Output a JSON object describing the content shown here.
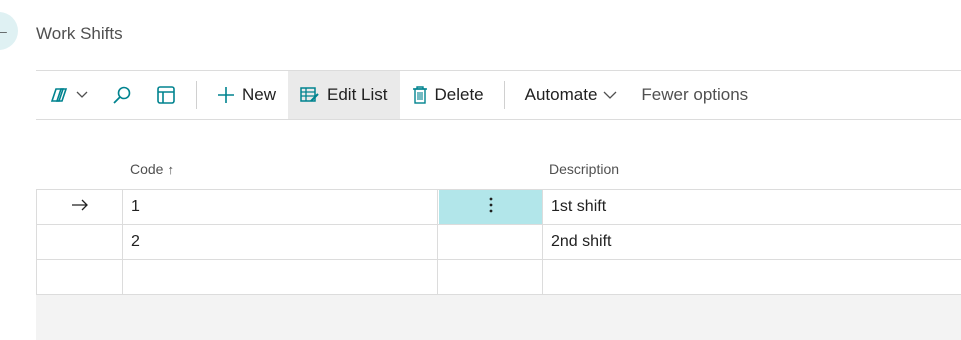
{
  "page": {
    "title": "Work Shifts"
  },
  "toolbar": {
    "new_label": "New",
    "edit_list_label": "Edit List",
    "delete_label": "Delete",
    "automate_label": "Automate",
    "fewer_options_label": "Fewer options"
  },
  "grid": {
    "columns": {
      "code": "Code",
      "description": "Description"
    },
    "sort_indicator": "↑",
    "rows": [
      {
        "code": "1",
        "description": "1st shift",
        "selected": true
      },
      {
        "code": "2",
        "description": "2nd shift",
        "selected": false
      },
      {
        "code": "",
        "description": "",
        "selected": false
      }
    ]
  },
  "icons": {
    "copilot": "copilot-icon",
    "search": "search-icon",
    "filter_pane": "filter-pane-icon",
    "new": "plus-icon",
    "edit_list": "edit-list-icon",
    "delete": "trash-icon",
    "row_selector": "arrow-right-icon",
    "row_menu": "vertical-ellipsis-icon"
  },
  "colors": {
    "accent": "#00838f",
    "focused_cell": "#b2e6ea",
    "back_circle": "#dff1f3"
  }
}
